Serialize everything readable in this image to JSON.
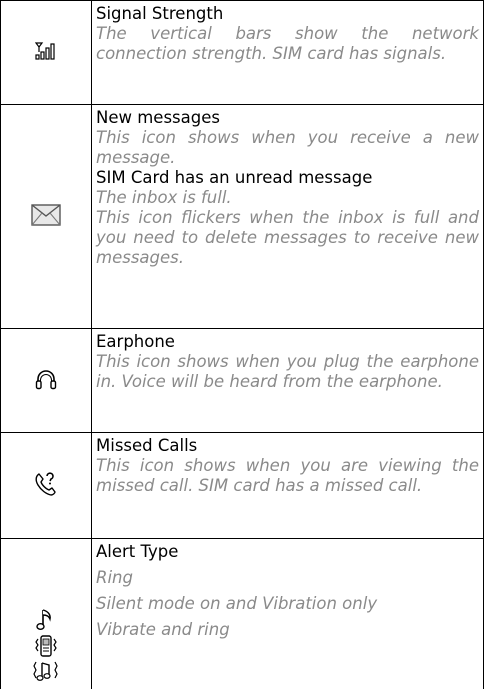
{
  "rows": [
    {
      "title": "Signal Strength",
      "desc": "The vertical bars show the network connection strength. SIM card has signals.",
      "icon": "signal-strength-icon"
    },
    {
      "entries": [
        {
          "title": "New messages",
          "desc": "This icon shows when you receive a new message."
        },
        {
          "title": "SIM Card has an unread message",
          "desc": "The inbox is full."
        }
      ],
      "extra_desc": "This icon flickers when the inbox is full and you need to delete messages to receive new messages.",
      "icon": "envelope-icon"
    },
    {
      "title": "Earphone",
      "desc": "This icon shows when you plug the earphone in. Voice will be heard from the earphone.",
      "icon": "headphone-icon"
    },
    {
      "title": "Missed Calls",
      "desc": "This icon shows when you are viewing the missed call. SIM card has a missed call.",
      "icon": "missed-call-icon"
    },
    {
      "title": "Alert Type",
      "items": [
        "Ring",
        "Silent mode on and Vibration only",
        "Vibrate and ring"
      ],
      "icons": [
        "ring-note-icon",
        "vibrate-icon",
        "vibrate-ring-icon"
      ]
    }
  ],
  "colors": {
    "title": "#000000",
    "description": "#8a8a8a",
    "border": "#000000"
  }
}
